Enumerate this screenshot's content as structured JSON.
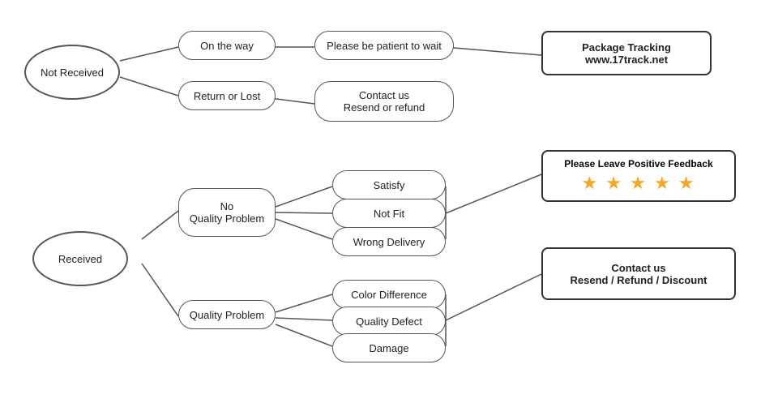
{
  "nodes": {
    "not_received": {
      "label": "Not\nReceived"
    },
    "received": {
      "label": "Received"
    },
    "on_the_way": {
      "label": "On the way"
    },
    "return_or_lost": {
      "label": "Return or Lost"
    },
    "please_be_patient": {
      "label": "Please be patient to wait"
    },
    "contact_us_resend_refund": {
      "label": "Contact us\nResend or refund"
    },
    "package_tracking": {
      "label": "Package Tracking\nwww.17track.net"
    },
    "no_quality_problem": {
      "label": "No\nQuality Problem"
    },
    "quality_problem": {
      "label": "Quality Problem"
    },
    "satisfy": {
      "label": "Satisfy"
    },
    "not_fit": {
      "label": "Not Fit"
    },
    "wrong_delivery": {
      "label": "Wrong Delivery"
    },
    "color_difference": {
      "label": "Color Difference"
    },
    "quality_defect": {
      "label": "Quality Defect"
    },
    "damage": {
      "label": "Damage"
    },
    "please_leave_feedback": {
      "title": "Please Leave Positive Feedback",
      "stars": "★ ★ ★ ★ ★"
    },
    "contact_us_resend_refund_discount": {
      "label": "Contact us\nResend / Refund / Discount"
    }
  }
}
